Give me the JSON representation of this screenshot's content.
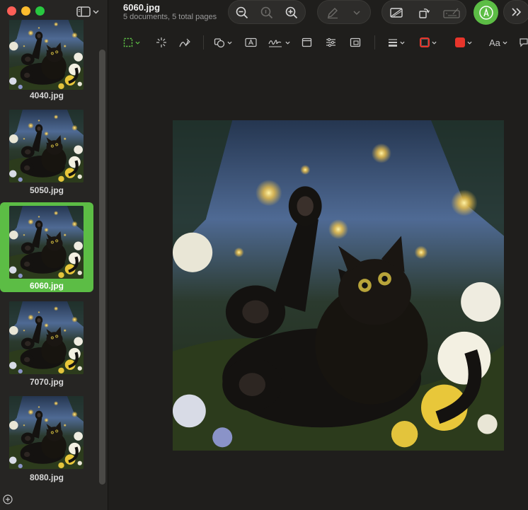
{
  "document": {
    "title": "6060.jpg",
    "subtitle": "5 documents, 5 total pages"
  },
  "sidebar": {
    "thumbnails": [
      {
        "label": "4040.jpg",
        "selected": false
      },
      {
        "label": "5050.jpg",
        "selected": false
      },
      {
        "label": "6060.jpg",
        "selected": true
      },
      {
        "label": "7070.jpg",
        "selected": false
      },
      {
        "label": "8080.jpg",
        "selected": false
      }
    ]
  },
  "toolbar": {
    "text_style_label": "Aa"
  },
  "colors": {
    "accent": "#5cbd45",
    "border_color": "#e8352b",
    "fill_color": "#e8352b"
  },
  "icons": {
    "sidebar_toggle": "sidebar-icon",
    "zoom_out": "zoom-out-icon",
    "actual_size": "actual-size-icon",
    "zoom_in": "zoom-in-icon",
    "highlight": "pencil-icon",
    "rotate": "rotate-icon",
    "crop": "crop-icon",
    "sign": "signature-icon",
    "markup": "markup-icon",
    "more": "chevrons-right-icon"
  }
}
